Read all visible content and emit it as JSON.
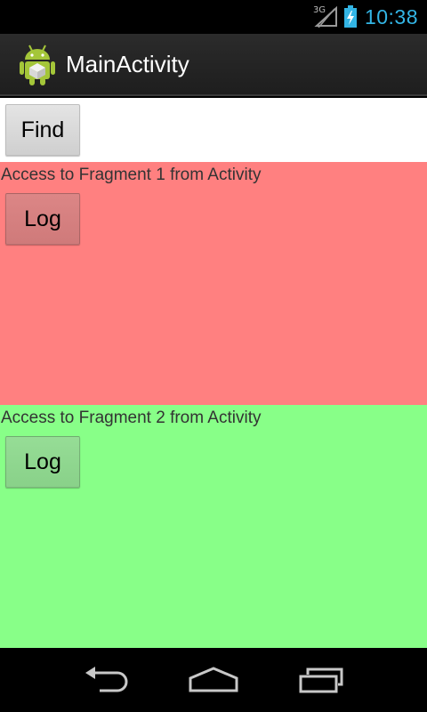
{
  "status_bar": {
    "network_type": "3G",
    "time": "10:38",
    "signal_icon": "signal-strength-icon",
    "battery_icon": "battery-charging-icon",
    "accent_color": "#33b5e5"
  },
  "action_bar": {
    "title": "MainActivity",
    "app_icon": "android-robot-icon"
  },
  "main": {
    "find_label": "Find"
  },
  "fragments": [
    {
      "label": "Access to Fragment 1 from Activity",
      "button_label": "Log",
      "background_color": "#ff8080"
    },
    {
      "label": "Access to Fragment 2 from Activity",
      "button_label": "Log",
      "background_color": "#88ff88"
    }
  ],
  "nav_bar": {
    "back_icon": "back-icon",
    "home_icon": "home-icon",
    "recents_icon": "recent-apps-icon"
  }
}
